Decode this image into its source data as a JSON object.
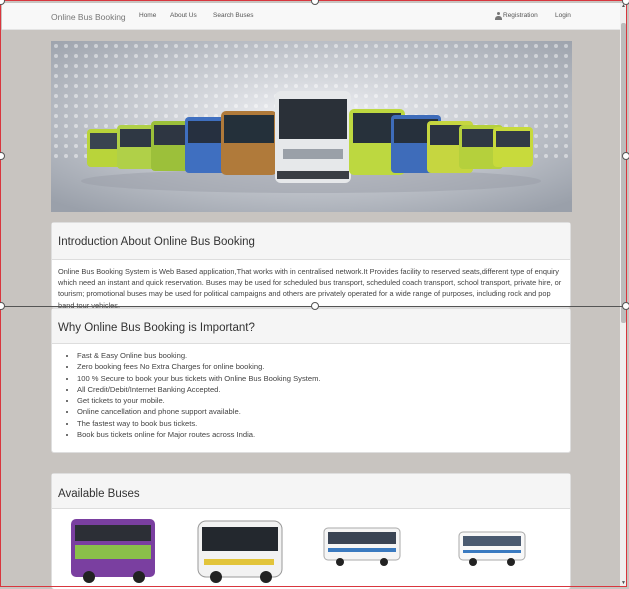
{
  "navbar": {
    "brand": "Online Bus Booking",
    "links": [
      "Home",
      "About Us",
      "Search Buses"
    ],
    "registration": "Registration",
    "login": "Login"
  },
  "intro": {
    "title": "Introduction About Online Bus Booking",
    "text": "Online Bus Booking System is Web Based application,That works with in centralised network.It Provides facility to reserved seats,different type of enquiry which need an instant and quick reservation. Buses may be used for scheduled bus transport, scheduled coach transport, school transport, private hire, or tourism; promotional buses may be used for political campaigns and others are privately operated for a wide range of purposes, including rock and pop band tour vehicles."
  },
  "why": {
    "title": "Why Online Bus Booking is Important?",
    "items": [
      "Fast & Easy Online bus booking.",
      "Zero booking fees No Extra Charges for online booking.",
      "100 % Secure to book your bus tickets with Online Bus Booking System.",
      "All Credit/Debit/Internet Banking Accepted.",
      "Get tickets to your mobile.",
      "Online cancellation and phone support available.",
      "The fastest way to book bus tickets.",
      "Book bus tickets online for Major routes across India."
    ]
  },
  "available": {
    "title": "Available Buses"
  },
  "colors": {
    "page_bg": "#c8c4c0",
    "panel_bg": "#ffffff",
    "panel_head": "#f5f5f5",
    "selection": "#d9363e"
  },
  "icons": [
    "user-icon"
  ]
}
